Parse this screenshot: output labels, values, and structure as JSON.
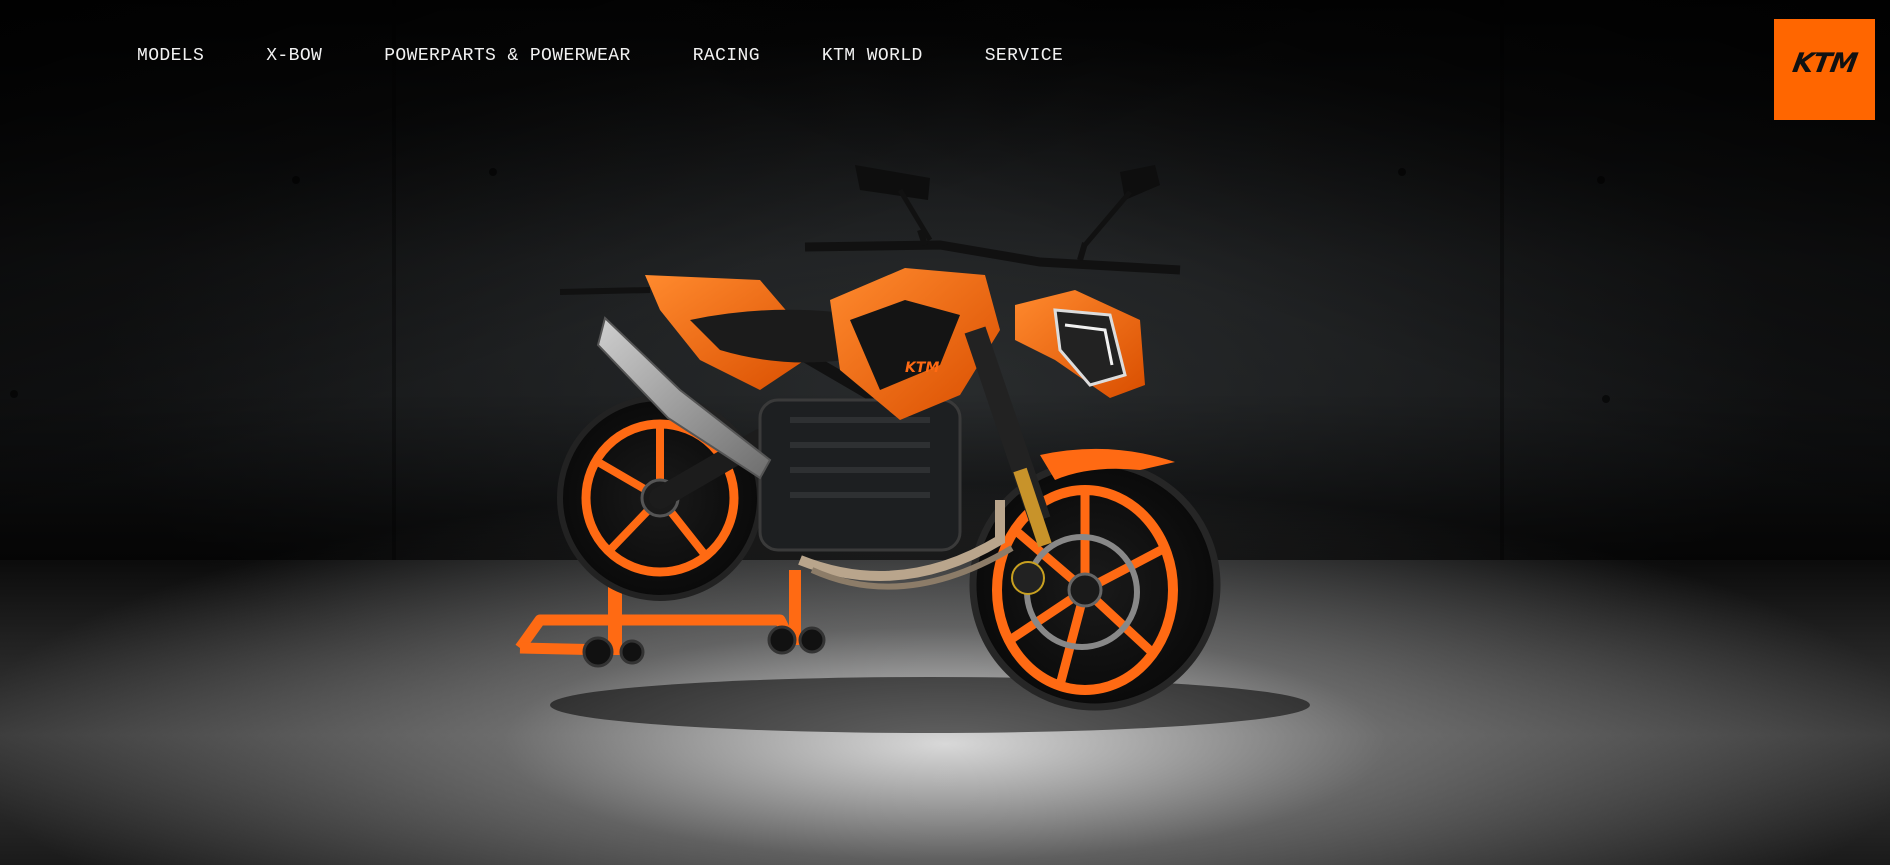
{
  "nav": {
    "items": [
      {
        "label": "MODELS"
      },
      {
        "label": "X-BOW"
      },
      {
        "label": "POWERPARTS & POWERWEAR"
      },
      {
        "label": "RACING"
      },
      {
        "label": "KTM WORLD"
      },
      {
        "label": "SERVICE"
      }
    ]
  },
  "logo": {
    "text": "KTM",
    "color": "#ff6600"
  },
  "hero": {
    "image_subject": "orange KTM naked motorcycle on paddock stand",
    "accent_color": "#ff6a13"
  }
}
